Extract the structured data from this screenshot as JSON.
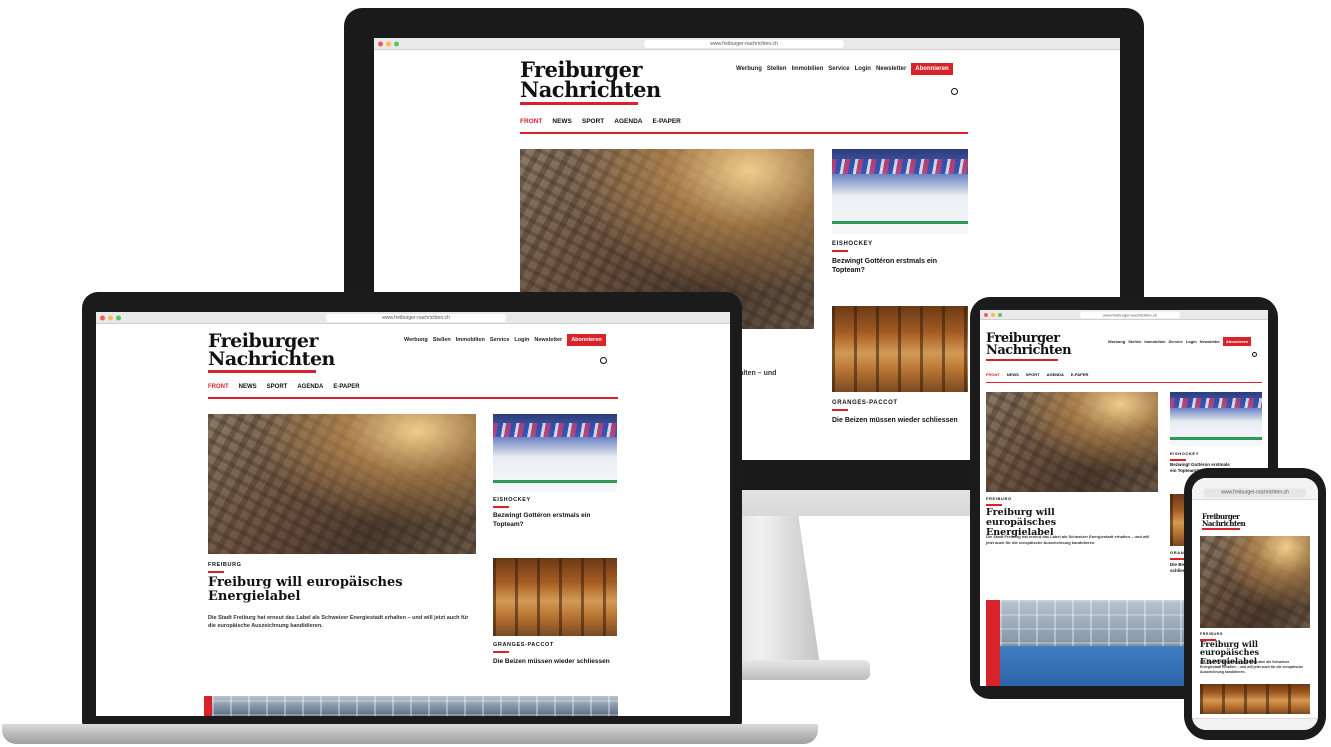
{
  "site": {
    "url": "www.freiburger-nachrichten.ch",
    "logo_line1": "Freiburger",
    "logo_line2": "Nachrichten",
    "topnav": [
      "Werbung",
      "Stellen",
      "Immobilien",
      "Service",
      "Login",
      "Newsletter"
    ],
    "subscribe": "Abonnieren",
    "mainnav": [
      "FRONT",
      "NEWS",
      "SPORT",
      "AGENDA",
      "E-PAPER"
    ],
    "active_nav": "FRONT",
    "lead_kicker": "FREIBURG",
    "lead_headline": "Freiburg will europäisches Energielabel",
    "lead_text": "Die Stadt Freiburg hat erneut das Label als Schweizer Energiestadt erhalten – und will jetzt auch für die europäische Auszeichnung kandidieren.",
    "lead_text_fragment": "dt erhalten – und",
    "teaser1_kicker": "EISHOCKEY",
    "teaser1_title": "Bezwingt Gottéron erstmals ein Topteam?",
    "teaser2_kicker": "GRANGES-PACCOT",
    "teaser2_title": "Die Beizen müssen wieder schliessen",
    "tablet_teaser2_fragment": "Die Bei schliess",
    "tablet_granges_fragment": "GRANGE",
    "phone_logo": "Freiburger Nachrichten",
    "phone_kicker": "FREIBURG",
    "phone_url": "www.freiburger-nachrichten.ch"
  },
  "colors": {
    "brand_red": "#d8232a",
    "frame": "#1b1b1b"
  },
  "icons": [
    "search-icon",
    "window-close-dot-icon",
    "window-minimize-dot-icon",
    "window-zoom-dot-icon"
  ]
}
